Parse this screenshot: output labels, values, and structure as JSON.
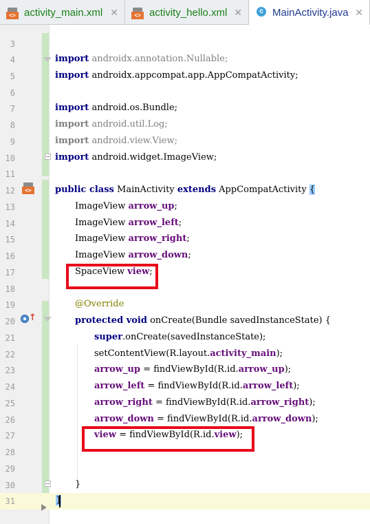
{
  "tabs": [
    {
      "label": "activity_main.xml",
      "icon": "xml-file-icon"
    },
    {
      "label": "activity_hello.xml",
      "icon": "xml-file-icon"
    },
    {
      "label": "MainActivity.java",
      "icon": "class-file-icon"
    }
  ],
  "tab_close": "✕",
  "file_icon_text": "<>",
  "class_icon_text": "c",
  "lines": {
    "l3": "3",
    "l4": "4",
    "l5": "5",
    "l6": "6",
    "l7": "7",
    "l8": "8",
    "l9": "9",
    "l10": "10",
    "l11": "11",
    "l12": "12",
    "l13": "13",
    "l14": "14",
    "l15": "15",
    "l16": "16",
    "l17": "17",
    "l18": "18",
    "l19": "19",
    "l20": "20",
    "l21": "21",
    "l22": "22",
    "l23": "23",
    "l24": "24",
    "l25": "25",
    "l26": "26",
    "l27": "27",
    "l28": "28",
    "l29": "29",
    "l30": "30",
    "l31": "31"
  },
  "code": {
    "import": "import",
    "l4": " androidx.annotation.Nullable;",
    "l5": " androidx.appcompat.app.AppCompatActivity;",
    "l7": " android.os.Bundle;",
    "l8": " android.util.Log;",
    "l9": " android.view.View;",
    "l10": " android.widget.ImageView;",
    "public_class": "public class",
    "class_name": " MainActivity ",
    "extends": "extends",
    "superclass": " AppCompatActivity ",
    "open_brace": "{",
    "ImageView": "ImageView ",
    "arrow_up": "arrow_up",
    "arrow_left": "arrow_left",
    "arrow_right": "arrow_right",
    "arrow_down": "arrow_down",
    "semi": ";",
    "SpaceView": "SpaceView ",
    "view": "view",
    "override": "@Override",
    "protected_void": "protected void",
    "onCreate_sig": " onCreate(Bundle savedInstanceState) {",
    "super": "super",
    "l21_rest": ".onCreate(savedInstanceState);",
    "l22_pre": "setContentView(R.layout.",
    "activity_main": "activity_main",
    "l22_post": ");",
    "eq_find": " = findViewById(R.id.",
    "close_call": ");",
    "close_brace": "}"
  },
  "colors": {
    "keyword": "#000080",
    "field": "#660e7a",
    "unused_import": "#808080",
    "annotation": "#808000",
    "highlight_box": "#e8091a",
    "vcs_changed": "#c9e7c2",
    "current_line": "#fbfad8"
  }
}
